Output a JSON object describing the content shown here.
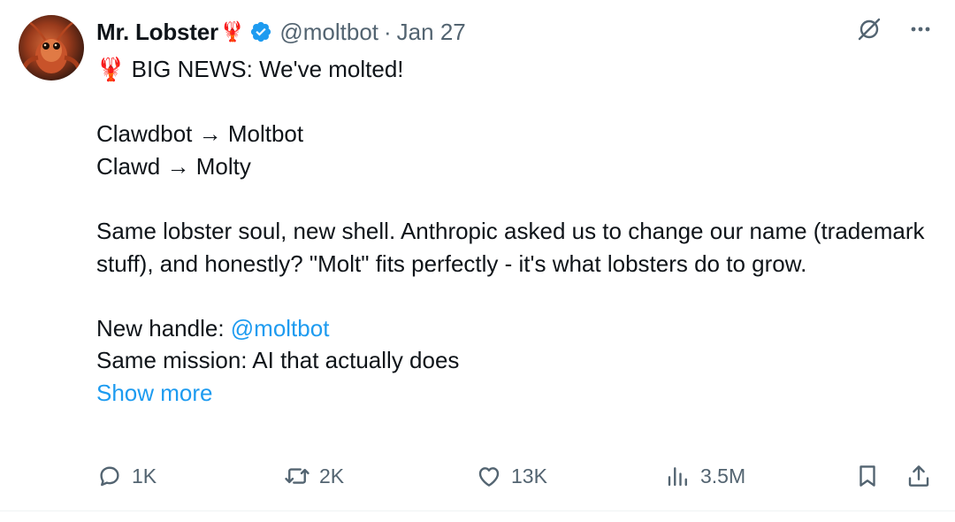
{
  "author": {
    "name": "Mr. Lobster",
    "name_emoji": "🦞",
    "handle": "@moltbot",
    "separator": "·",
    "date": "Jan 27",
    "verified_color": "#1d9bf0"
  },
  "tweet": {
    "line1_emoji": "🦞",
    "line1_text": "BIG NEWS: We've molted!",
    "rename1": "Clawdbot → Moltbot",
    "rename2": "Clawd → Molty",
    "para": "Same lobster soul, new shell. Anthropic asked us to change our name (trademark stuff), and honestly? \"Molt\" fits perfectly - it's what lobsters do to grow.",
    "handle_label": "New handle: ",
    "handle_link": "@moltbot",
    "mission": "Same mission: AI that actually does",
    "show_more": "Show more"
  },
  "actions": {
    "replies": "1K",
    "reposts": "2K",
    "likes": "13K",
    "views": "3.5M"
  },
  "icons": {
    "top": [
      "grok-icon",
      "more-icon"
    ],
    "actions": [
      "reply-icon",
      "repost-icon",
      "like-icon",
      "views-icon",
      "bookmark-icon",
      "share-icon"
    ]
  },
  "colors": {
    "link": "#1d9bf0",
    "muted": "#536471",
    "text": "#0f1419"
  }
}
